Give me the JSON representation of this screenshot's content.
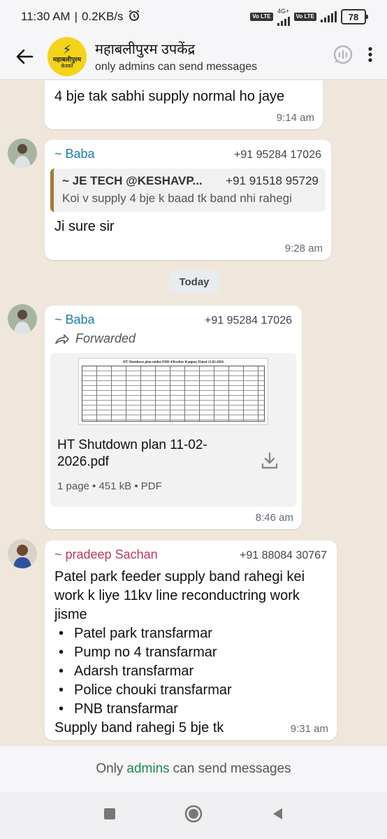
{
  "status_bar": {
    "time": "11:30 AM",
    "speed": "0.2KB/s",
    "alarm_icon": "alarm-icon",
    "volte_1": "Vo LTE",
    "network": "4G+",
    "volte_2": "Vo LTE",
    "battery": "78"
  },
  "header": {
    "title": "महाबलीपुरम उपकेंद्र",
    "subtitle": "only admins can send messages",
    "logo_text_1": "महाबलीपुरम",
    "logo_text_2": "केस्को"
  },
  "messages": [
    {
      "text": "4 bje tak sabhi supply normal ho jaye",
      "time": "9:14 am"
    },
    {
      "sender": "~ Baba",
      "phone": "+91 95284 17026",
      "quote_sender": "~ JE TECH @KESHAVP...",
      "quote_phone": "+91 91518 95729",
      "quote_text": "Koi v supply 4 bje k baad tk band nhi rahegi",
      "text": "Ji sure sir",
      "time": "9:28 am"
    },
    {
      "sender": "~ Baba",
      "phone": "+91 95284 17026",
      "forwarded": "Forwarded",
      "document_preview_title": "HT Shutdown plan under EDD 4/Keshav Kanpur, Dated 11.02.2026",
      "document_name": "HT Shutdown plan 11-02-2026.pdf",
      "document_meta": "1 page • 451 kB • PDF",
      "time": "8:46 am"
    },
    {
      "sender": "~ pradeep Sachan",
      "phone": "+91 88084 30767",
      "text": "Patel park feeder supply band rahegi kei work k liye 11kv line reconductring work jisme",
      "items": [
        "Patel park transfarmar",
        "Pump no 4 transfarmar",
        "Adarsh transfarmar",
        "Police chouki transfarmar",
        "PNB transfarmar"
      ],
      "closing": "Supply band rahegi 5 bje tk",
      "time": "9:31 am"
    }
  ],
  "date_separator": "Today",
  "footer": {
    "before": "Only",
    "admins": "admins",
    "after": "can send messages"
  },
  "colors": {
    "sender_blue": "#1b7fa8",
    "sender_red": "#c0375a",
    "admins_green": "#1a8a55",
    "chat_bg": "#efe7dc",
    "logo_yellow": "#f3d417"
  }
}
